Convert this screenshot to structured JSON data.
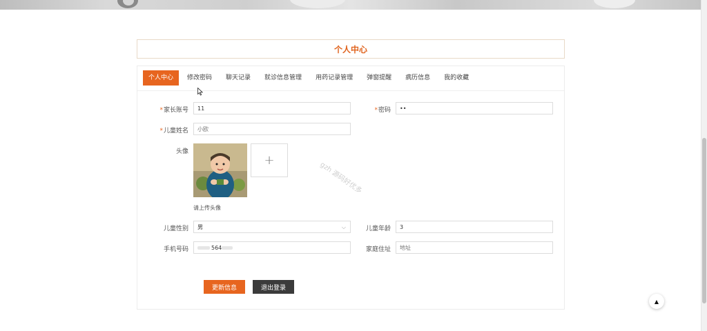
{
  "page": {
    "title": "个人中心"
  },
  "tabs": [
    {
      "label": "个人中心",
      "active": true
    },
    {
      "label": "修改密码",
      "active": false
    },
    {
      "label": "聊天记录",
      "active": false
    },
    {
      "label": "就诊信息管理",
      "active": false
    },
    {
      "label": "用药记录管理",
      "active": false
    },
    {
      "label": "弹窗提醒",
      "active": false
    },
    {
      "label": "病历信息",
      "active": false
    },
    {
      "label": "我的收藏",
      "active": false
    }
  ],
  "form": {
    "parent_account": {
      "label": "家长账号",
      "required": true,
      "value": "11"
    },
    "password": {
      "label": "密码",
      "required": true,
      "value": "••"
    },
    "child_name": {
      "label": "儿童姓名",
      "required": true,
      "value": "小欧"
    },
    "avatar": {
      "label": "头像",
      "hint": "请上传头像"
    },
    "child_gender": {
      "label": "儿童性别",
      "value": "男"
    },
    "child_age": {
      "label": "儿童年龄",
      "value": "3"
    },
    "phone": {
      "label": "手机号码",
      "value": "564"
    },
    "address": {
      "label": "家庭住址",
      "placeholder": "地址"
    }
  },
  "buttons": {
    "update": "更新信息",
    "logout": "退出登录"
  },
  "watermark": "gzh 源码好优多",
  "colors": {
    "accent": "#e7651f",
    "dark_button": "#3b3b3b",
    "title": "#e0631d"
  }
}
